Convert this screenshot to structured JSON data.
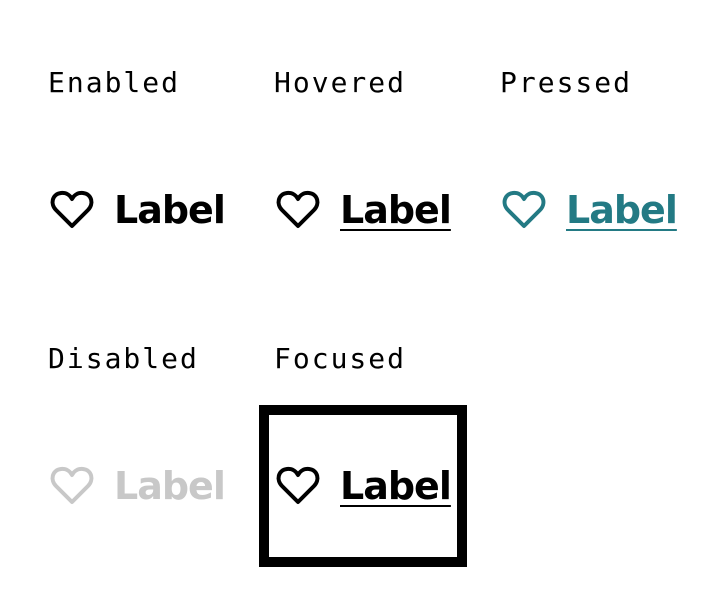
{
  "states": {
    "enabled": {
      "title": "Enabled",
      "label": "Label",
      "icon": "heart-outline-icon",
      "color": "#000000"
    },
    "hovered": {
      "title": "Hovered",
      "label": "Label",
      "icon": "heart-outline-icon",
      "color": "#000000"
    },
    "pressed": {
      "title": "Pressed",
      "label": "Label",
      "icon": "heart-outline-icon",
      "color": "#237a84"
    },
    "disabled": {
      "title": "Disabled",
      "label": "Label",
      "icon": "heart-outline-icon",
      "color": "#c8c8c8"
    },
    "focused": {
      "title": "Focused",
      "label": "Label",
      "icon": "heart-outline-icon",
      "color": "#000000",
      "focus_ring_color": "#000000"
    }
  }
}
